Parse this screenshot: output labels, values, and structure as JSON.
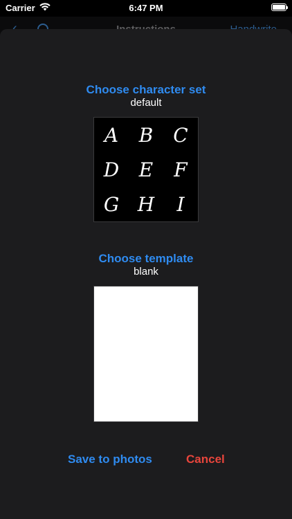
{
  "status_bar": {
    "carrier": "Carrier",
    "time": "6:47 PM",
    "wifi_icon": "wifi-icon",
    "battery_icon": "battery-icon"
  },
  "background_nav": {
    "back_icon": "chevron-left-icon",
    "info_icon": "info-icon",
    "title": "Instructions",
    "right_label": "Handwrite"
  },
  "sheet": {
    "charset": {
      "title": "Choose character set",
      "value": "default",
      "glyphs": [
        "A",
        "B",
        "C",
        "D",
        "E",
        "F",
        "G",
        "H",
        "I"
      ]
    },
    "template": {
      "title": "Choose template",
      "value": "blank"
    },
    "actions": {
      "save_label": "Save to photos",
      "cancel_label": "Cancel"
    }
  },
  "colors": {
    "accent": "#2f8bf0",
    "destructive": "#e8453c",
    "sheet_bg": "#1c1c1e"
  }
}
